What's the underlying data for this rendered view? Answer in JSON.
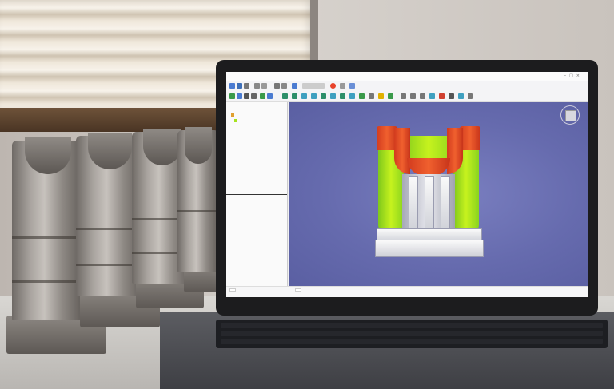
{
  "photo": {
    "description_kind": "photo of laptop on desk running CAD software with metal parts beside it"
  },
  "app": {
    "title": "",
    "tree_header": "",
    "tree_items": [
      "",
      ""
    ],
    "properties_label": "",
    "properties_value": "",
    "status_tabs": [
      "",
      ""
    ],
    "status_right": ""
  },
  "colors": {
    "model_red": "#e04a24",
    "model_green": "#a6e21e",
    "viewport_bg": "#6a6fb0",
    "laptop_frame": "#1c1c1e",
    "metal": "#a8a39e"
  },
  "icons": [
    "nav-cube-icon"
  ]
}
